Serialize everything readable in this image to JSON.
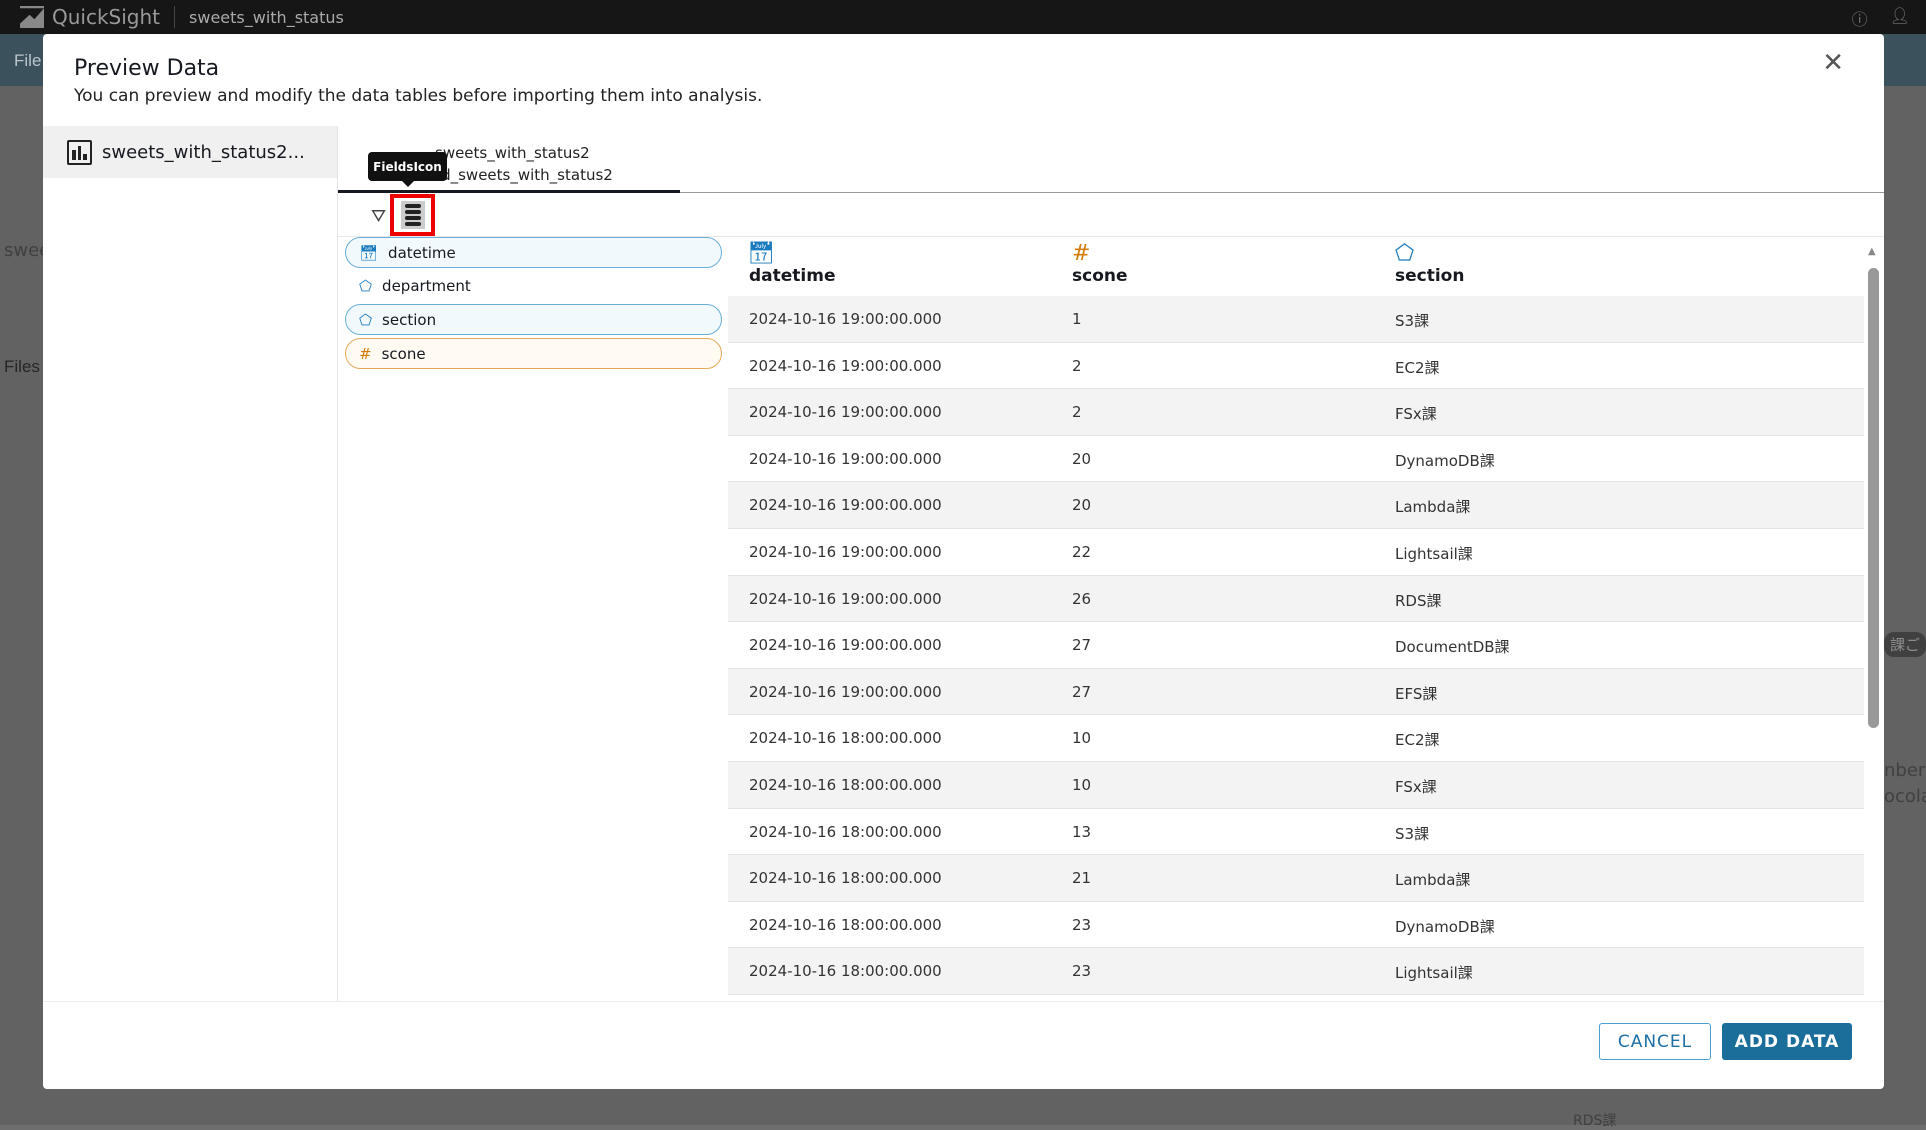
{
  "topbar": {
    "app": "QuickSight",
    "document": "sweets_with_status",
    "help_icon": "help-circle-icon",
    "user_icon": "user-icon"
  },
  "background": {
    "menu": "File",
    "dataset": "swee",
    "files": "Files",
    "right1": "nber",
    "right2": "ocola",
    "badge": "課ご",
    "bottom": "RDS課"
  },
  "modal": {
    "title": "Preview Data",
    "subtitle": "You can preview and modify the data tables before importing them into analysis.",
    "datasets": [
      {
        "label": "sweets_with_status2..."
      }
    ],
    "tab": {
      "line1": "sweets_with_status2",
      "line2": "ard_sweets_with_status2"
    },
    "tooltip": "FieldsIcon",
    "fields": [
      {
        "name": "datetime",
        "type": "date",
        "selected": true
      },
      {
        "name": "department",
        "type": "string",
        "selected": false
      },
      {
        "name": "section",
        "type": "string",
        "selected": true
      },
      {
        "name": "scone",
        "type": "number",
        "selected": true
      }
    ],
    "table": {
      "columns": [
        {
          "label": "datetime",
          "icon": "calendar-icon"
        },
        {
          "label": "scone",
          "icon": "hash-icon"
        },
        {
          "label": "section",
          "icon": "tag-icon"
        }
      ],
      "rows": [
        [
          "2024-10-16 19:00:00.000",
          "1",
          "S3課"
        ],
        [
          "2024-10-16 19:00:00.000",
          "2",
          "EC2課"
        ],
        [
          "2024-10-16 19:00:00.000",
          "2",
          "FSx課"
        ],
        [
          "2024-10-16 19:00:00.000",
          "20",
          "DynamoDB課"
        ],
        [
          "2024-10-16 19:00:00.000",
          "20",
          "Lambda課"
        ],
        [
          "2024-10-16 19:00:00.000",
          "22",
          "Lightsail課"
        ],
        [
          "2024-10-16 19:00:00.000",
          "26",
          "RDS課"
        ],
        [
          "2024-10-16 19:00:00.000",
          "27",
          "DocumentDB課"
        ],
        [
          "2024-10-16 19:00:00.000",
          "27",
          "EFS課"
        ],
        [
          "2024-10-16 18:00:00.000",
          "10",
          "EC2課"
        ],
        [
          "2024-10-16 18:00:00.000",
          "10",
          "FSx課"
        ],
        [
          "2024-10-16 18:00:00.000",
          "13",
          "S3課"
        ],
        [
          "2024-10-16 18:00:00.000",
          "21",
          "Lambda課"
        ],
        [
          "2024-10-16 18:00:00.000",
          "23",
          "DynamoDB課"
        ],
        [
          "2024-10-16 18:00:00.000",
          "23",
          "Lightsail課"
        ]
      ]
    },
    "cancel": "CANCEL",
    "add": "ADD DATA"
  },
  "colors": {
    "primary": "#1b6e9a",
    "highlight": "#ee0000",
    "string_icon": "#1a7bbf",
    "number_icon": "#d47b0a"
  }
}
